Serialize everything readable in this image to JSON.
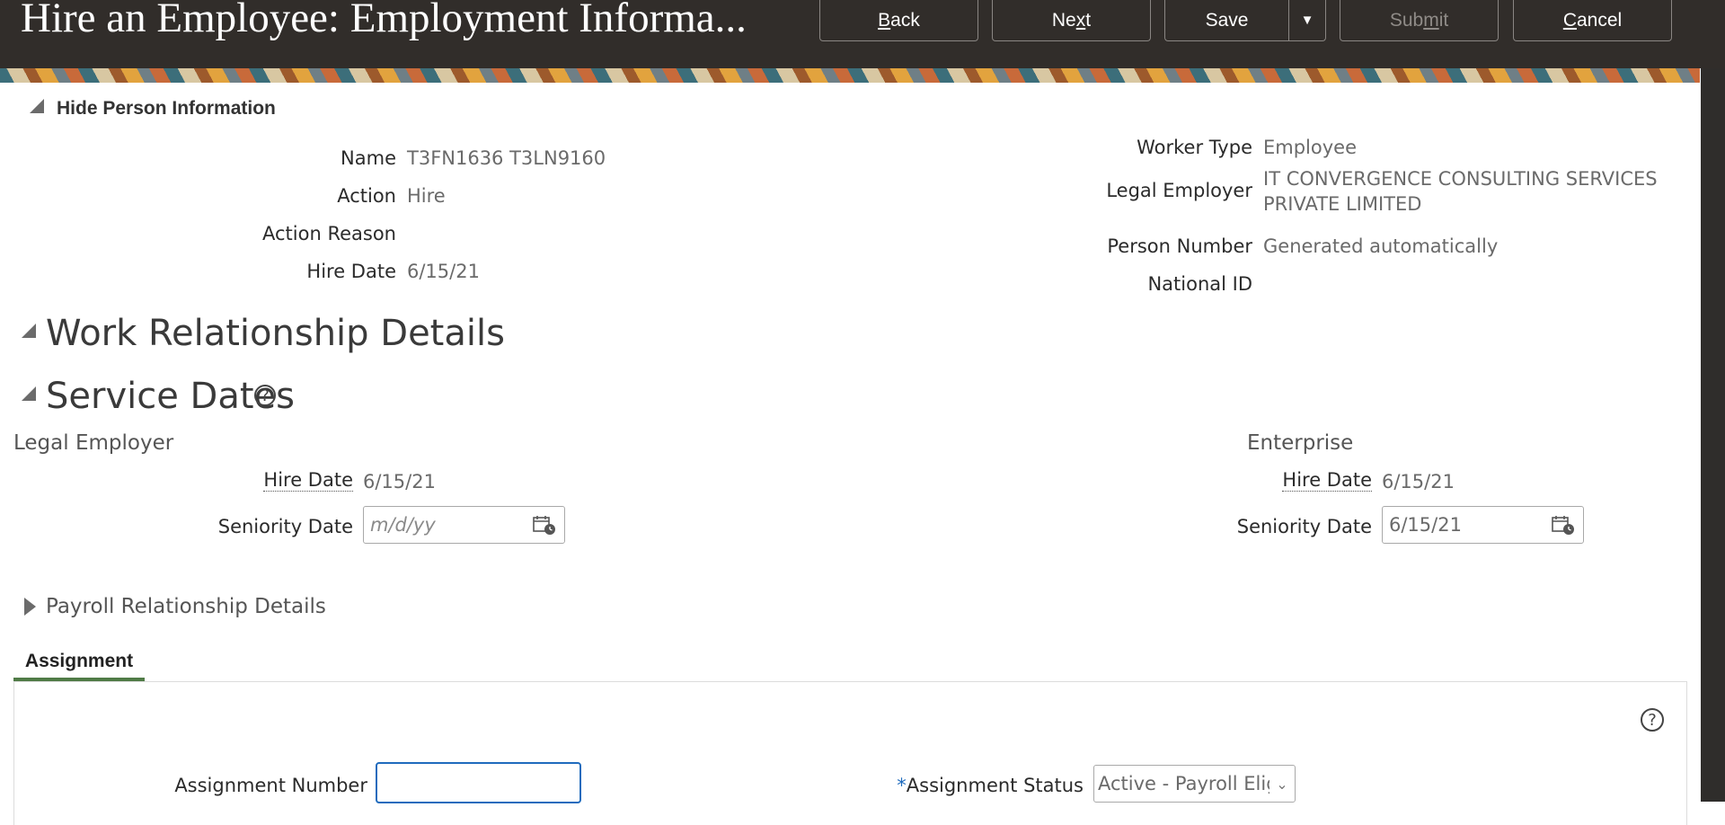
{
  "header": {
    "title": "Hire an Employee: Employment Informa...",
    "buttons": {
      "back": {
        "pre": "",
        "accel": "B",
        "post": "ack"
      },
      "next": {
        "pre": "Ne",
        "accel": "x",
        "post": "t"
      },
      "save": "Save",
      "submit": {
        "pre": "Sub",
        "accel": "m",
        "post": "it"
      },
      "cancel": {
        "pre": "",
        "accel": "C",
        "post": "ancel"
      }
    }
  },
  "person_info": {
    "toggle_label": "Hide Person Information",
    "left": [
      {
        "label": "Name",
        "value": "T3FN1636 T3LN9160"
      },
      {
        "label": "Action",
        "value": "Hire"
      },
      {
        "label": "Action Reason",
        "value": ""
      },
      {
        "label": "Hire Date",
        "value": "6/15/21"
      }
    ],
    "right": {
      "worker_type": {
        "label": "Worker Type",
        "value": "Employee"
      },
      "legal_employer": {
        "label": "Legal Employer",
        "value_line1": "IT CONVERGENCE CONSULTING SERVICES",
        "value_line2": "PRIVATE LIMITED"
      },
      "person_number": {
        "label": "Person Number",
        "value": "Generated automatically"
      },
      "national_id": {
        "label": "National ID",
        "value": ""
      }
    }
  },
  "work_relationship": {
    "heading": "Work Relationship Details"
  },
  "service_dates": {
    "heading": "Service Dates",
    "help": "?",
    "legal_employer": {
      "heading": "Legal Employer",
      "hire_date_label": "Hire Date",
      "hire_date_value": "6/15/21",
      "seniority_label": "Seniority Date",
      "seniority_placeholder": "m/d/yy"
    },
    "enterprise": {
      "heading": "Enterprise",
      "hire_date_label": "Hire Date",
      "hire_date_value": "6/15/21",
      "seniority_label": "Seniority Date",
      "seniority_value": "6/15/21"
    }
  },
  "payroll": {
    "heading": "Payroll Relationship Details"
  },
  "assignment": {
    "tab_label": "Assignment",
    "help": "?",
    "number_label": "Assignment Number",
    "number_value": "",
    "status_required": "*",
    "status_label": "Assignment Status",
    "status_value": "Active - Payroll Elig"
  },
  "icons": {
    "collapse": "triangle-down-icon",
    "expand": "triangle-right-icon",
    "calendar": "calendar-icon",
    "help": "help-icon",
    "dropdown": "chevron-down-icon"
  }
}
